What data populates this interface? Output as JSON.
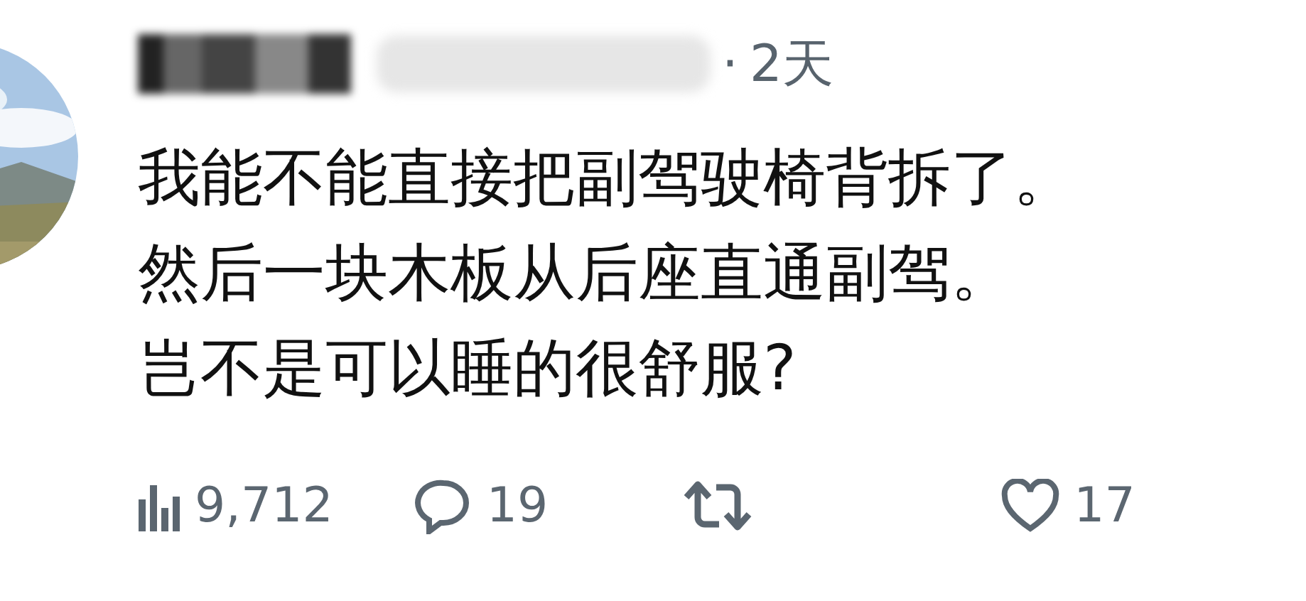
{
  "post": {
    "author": {
      "redacted": true
    },
    "separator": "·",
    "time": "2天",
    "lines": [
      "我能不能直接把副驾驶椅背拆了。",
      "然后一块木板从后座直通副驾。",
      "岂不是可以睡的很舒服?"
    ],
    "actions": [
      {
        "kind": "views",
        "count": "9,712"
      },
      {
        "kind": "reply",
        "count": "19"
      },
      {
        "kind": "repost"
      },
      {
        "kind": "like",
        "count": "17"
      }
    ]
  }
}
